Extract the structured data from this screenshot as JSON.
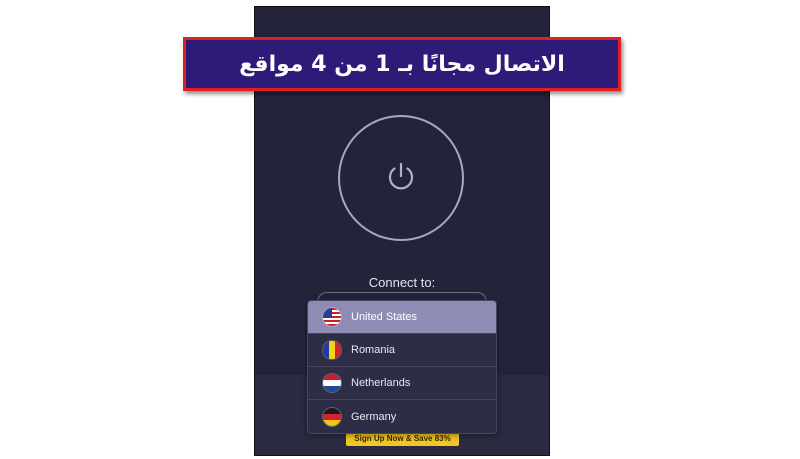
{
  "banner": {
    "text": "الاتصال مجانًا بـ 1 من 4 مواقع"
  },
  "app": {
    "connect_label": "Connect to:",
    "power_button": {
      "icon": "power-icon"
    },
    "promo_button": {
      "label": "Sign Up Now & Save 83%"
    }
  },
  "dropdown": {
    "options": [
      {
        "label": "United States",
        "flag": "us-flag-icon",
        "selected": true
      },
      {
        "label": "Romania",
        "flag": "romania-flag-icon",
        "selected": false
      },
      {
        "label": "Netherlands",
        "flag": "netherlands-flag-icon",
        "selected": false
      },
      {
        "label": "Germany",
        "flag": "germany-flag-icon",
        "selected": false
      }
    ]
  },
  "colors": {
    "app_background": "#23233a",
    "accent_selected": "#8e8bb5",
    "banner_background": "#2e1b78",
    "banner_border": "#e02020",
    "promo": "#f3c623"
  }
}
